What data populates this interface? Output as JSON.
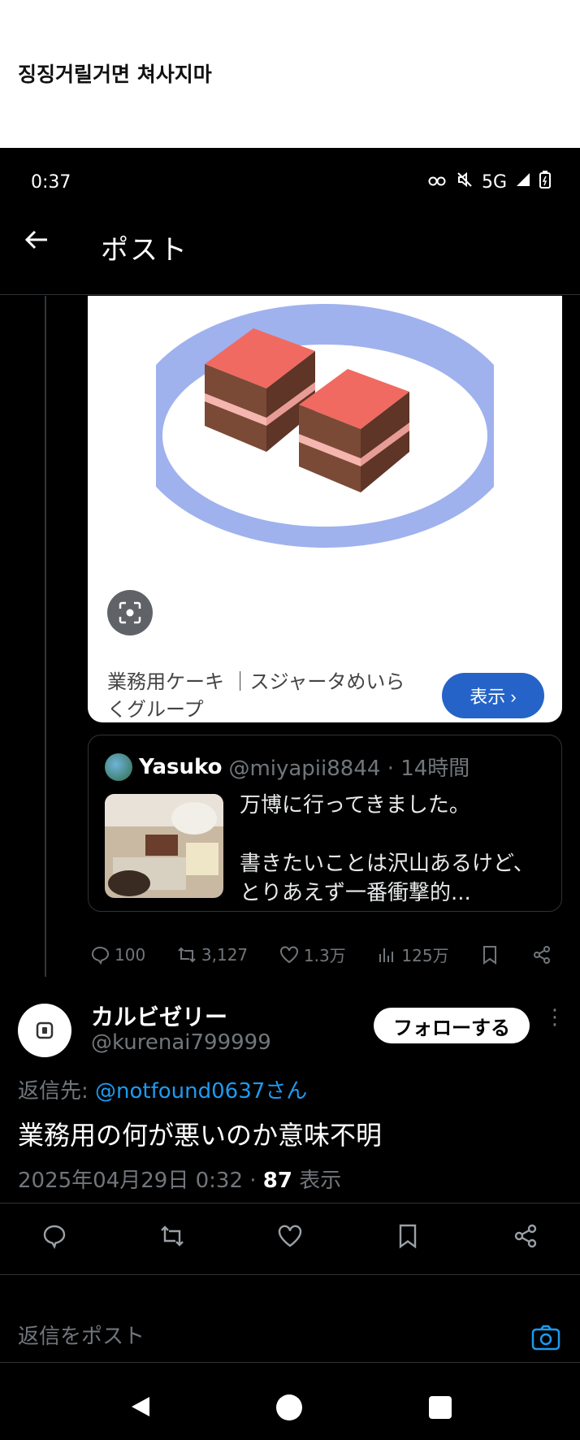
{
  "caption": "징징거릴거면 쳐사지마",
  "status": {
    "time": "0:37",
    "network": "5G"
  },
  "appbar": {
    "title": "ポスト"
  },
  "card": {
    "title": "業務用ケーキ ｜スジャータめいらくグループ",
    "button_label": "表示 ›"
  },
  "quote": {
    "name": "Yasuko",
    "handle_time": "@miyapii8844 · 14時間",
    "text_line1": "万博に行ってきました。",
    "text_line2": "書きたいことは沢山あるけど、とりあえず一番衝撃的..."
  },
  "actions_small": {
    "replies": "100",
    "reposts": "3,127",
    "likes": "1.3万",
    "views": "125万"
  },
  "author": {
    "name": "カルビゼリー",
    "handle": "@kurenai799999",
    "follow_label": "フォローする"
  },
  "post": {
    "reply_prefix": "返信先: ",
    "reply_mention": "@notfound0637さん",
    "text": "業務用の何が悪いのか意味不明",
    "datetime": "2025年04月29日 0:32 · ",
    "view_count": "87",
    "view_label": " 表示"
  },
  "reply_bar": {
    "placeholder": "返信をポスト"
  },
  "colors": {
    "accent": "#1d9bf0",
    "card_button": "#2563c9",
    "background": "#000000",
    "muted": "#71767b"
  }
}
